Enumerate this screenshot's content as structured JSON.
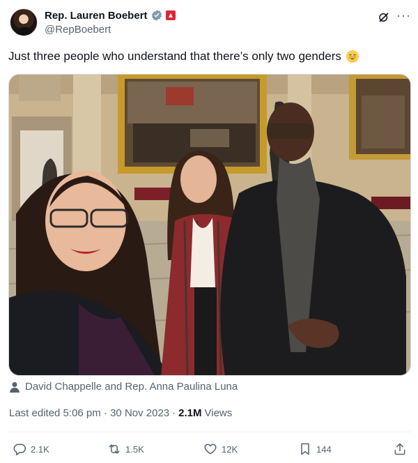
{
  "author": {
    "display_name": "Rep. Lauren Boebert",
    "handle": "@RepBoebert"
  },
  "tweet": {
    "text": "Just three people who understand that there’s only two genders",
    "emoji": "grinning-face-with-smiling-eyes"
  },
  "media": {
    "tagged_people": "David Chappelle and Rep. Anna Paulina Luna"
  },
  "meta": {
    "edited_label": "Last edited 5:06 pm · 30 Nov 2023",
    "views_count": "2.1M",
    "views_label": "Views"
  },
  "actions": {
    "replies": "2.1K",
    "reposts": "1.5K",
    "likes": "12K",
    "bookmarks": "144"
  },
  "icons": {
    "verified": "verified-badge-icon",
    "grok": "grok-icon",
    "more": "more-icon",
    "reply": "reply-icon",
    "repost": "repost-icon",
    "like": "like-icon",
    "bookmark": "bookmark-icon",
    "share": "share-icon",
    "person": "person-icon"
  },
  "colors": {
    "verified_blue": "#1d9bf0",
    "secondary_text": "#536471",
    "primary_text": "#0f1419",
    "divider": "#eff3f4"
  }
}
